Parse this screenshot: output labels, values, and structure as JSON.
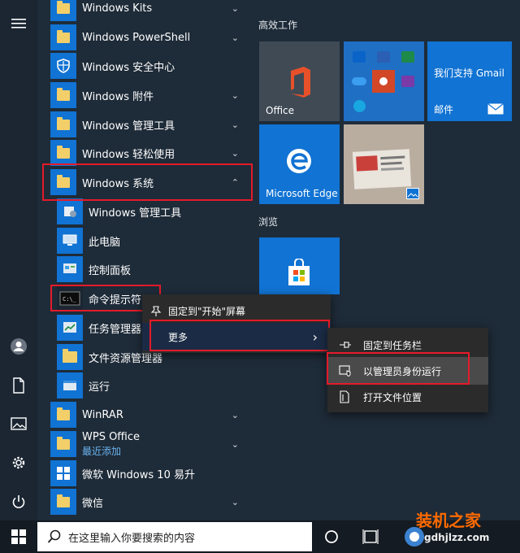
{
  "app_list": {
    "items": [
      {
        "label": "Windows Kits",
        "chev": "⌄"
      },
      {
        "label": "Windows PowerShell",
        "chev": "⌄"
      },
      {
        "label": "Windows 安全中心",
        "chev": ""
      },
      {
        "label": "Windows 附件",
        "chev": "⌄"
      },
      {
        "label": "Windows 管理工具",
        "chev": "⌄"
      },
      {
        "label": "Windows 轻松使用",
        "chev": "⌄"
      },
      {
        "label": "Windows 系统",
        "chev": "⌃"
      }
    ],
    "sub_items": [
      {
        "label": "Windows 管理工具"
      },
      {
        "label": "此电脑"
      },
      {
        "label": "控制面板"
      },
      {
        "label": "命令提示符"
      },
      {
        "label": "任务管理器"
      },
      {
        "label": "文件资源管理器"
      },
      {
        "label": "运行"
      }
    ],
    "more_items": [
      {
        "label": "WinRAR",
        "chev": "⌄"
      },
      {
        "label": "WPS Office",
        "sub": "最近添加",
        "chev": "⌄"
      },
      {
        "label": "微软 Windows 10 易升",
        "chev": ""
      },
      {
        "label": "微信",
        "chev": "⌄"
      }
    ]
  },
  "tiles": {
    "group1": "高效工作",
    "group2": "浏览",
    "office_label": "Office",
    "gmail_label": "我们支持 Gmail",
    "mail_label": "邮件",
    "edge_label": "Microsoft Edge"
  },
  "context_menu": {
    "pin_start": "固定到\"开始\"屏幕",
    "more": "更多",
    "more_arrow": "›"
  },
  "submenu": {
    "pin_taskbar": "固定到任务栏",
    "run_as_admin": "以管理员身份运行",
    "open_location": "打开文件位置"
  },
  "taskbar": {
    "search_placeholder": "在这里输入你要搜索的内容"
  },
  "watermark": {
    "title": "装机之家",
    "url": "gdhjlzz.com"
  },
  "colors": {
    "accent": "#1173d3",
    "highlight_box": "#e51a2a"
  }
}
